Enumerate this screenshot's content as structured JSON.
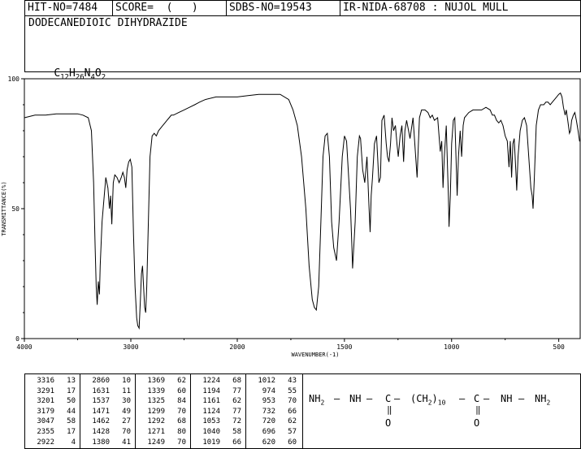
{
  "header": {
    "hit_no": "HIT-NO=7484",
    "score": "SCORE=  (   )",
    "sdbs_no": "SDBS-NO=19543",
    "ir_nida": "IR-NIDA-68708 : NUJOL MULL"
  },
  "compound": {
    "name": "DODECANEDIOIC DIHYDRAZIDE",
    "formula_parts": [
      "C",
      "12",
      "H",
      "26",
      "N",
      "4",
      "O",
      "2"
    ]
  },
  "chart_data": {
    "type": "line",
    "xlabel": "WAVENUMBER(-1)",
    "ylabel": "TRANSMITTANCE(%)",
    "xlim": [
      4000,
      400
    ],
    "ylim": [
      0,
      100
    ],
    "x_ticks": [
      4000,
      3000,
      2000,
      1500,
      1000,
      500
    ],
    "y_ticks": [
      0,
      50,
      100
    ],
    "x_tick_labels": [
      "4000",
      "3000",
      "2000",
      "1500",
      "1000",
      "500"
    ],
    "y_tick_labels": [
      "0",
      "50",
      "100"
    ],
    "series": [
      {
        "color": "#000000",
        "points": [
          [
            4000,
            85
          ],
          [
            3900,
            86
          ],
          [
            3800,
            86
          ],
          [
            3700,
            86.5
          ],
          [
            3600,
            86.5
          ],
          [
            3500,
            86.5
          ],
          [
            3450,
            86
          ],
          [
            3400,
            85
          ],
          [
            3370,
            80
          ],
          [
            3350,
            60
          ],
          [
            3335,
            35
          ],
          [
            3325,
            20
          ],
          [
            3316,
            13
          ],
          [
            3305,
            22
          ],
          [
            3295,
            17
          ],
          [
            3288,
            28
          ],
          [
            3270,
            45
          ],
          [
            3250,
            55
          ],
          [
            3235,
            62
          ],
          [
            3215,
            58
          ],
          [
            3201,
            50
          ],
          [
            3190,
            55
          ],
          [
            3179,
            44
          ],
          [
            3165,
            60
          ],
          [
            3150,
            63
          ],
          [
            3130,
            62
          ],
          [
            3110,
            60
          ],
          [
            3090,
            62
          ],
          [
            3075,
            64
          ],
          [
            3060,
            62
          ],
          [
            3047,
            58
          ],
          [
            3035,
            65
          ],
          [
            3020,
            68
          ],
          [
            3005,
            69
          ],
          [
            2990,
            66
          ],
          [
            2975,
            40
          ],
          [
            2960,
            20
          ],
          [
            2945,
            8
          ],
          [
            2935,
            5
          ],
          [
            2922,
            4
          ],
          [
            2910,
            15
          ],
          [
            2900,
            25
          ],
          [
            2890,
            28
          ],
          [
            2880,
            20
          ],
          [
            2870,
            12
          ],
          [
            2860,
            10
          ],
          [
            2850,
            20
          ],
          [
            2835,
            45
          ],
          [
            2820,
            70
          ],
          [
            2800,
            78
          ],
          [
            2780,
            79
          ],
          [
            2760,
            78
          ],
          [
            2740,
            80
          ],
          [
            2720,
            81
          ],
          [
            2700,
            82
          ],
          [
            2680,
            83
          ],
          [
            2660,
            84
          ],
          [
            2640,
            85
          ],
          [
            2620,
            86
          ],
          [
            2600,
            86
          ],
          [
            2550,
            87
          ],
          [
            2500,
            88
          ],
          [
            2450,
            89
          ],
          [
            2400,
            90
          ],
          [
            2355,
            91
          ],
          [
            2300,
            92
          ],
          [
            2200,
            93
          ],
          [
            2100,
            93
          ],
          [
            2000,
            93
          ],
          [
            1950,
            93.5
          ],
          [
            1900,
            94
          ],
          [
            1850,
            94
          ],
          [
            1800,
            94
          ],
          [
            1760,
            92
          ],
          [
            1740,
            88
          ],
          [
            1720,
            82
          ],
          [
            1700,
            70
          ],
          [
            1680,
            50
          ],
          [
            1665,
            28
          ],
          [
            1650,
            15
          ],
          [
            1640,
            12
          ],
          [
            1631,
            11
          ],
          [
            1620,
            20
          ],
          [
            1610,
            45
          ],
          [
            1600,
            70
          ],
          [
            1590,
            78
          ],
          [
            1580,
            79
          ],
          [
            1570,
            70
          ],
          [
            1560,
            45
          ],
          [
            1550,
            35
          ],
          [
            1537,
            30
          ],
          [
            1525,
            45
          ],
          [
            1510,
            70
          ],
          [
            1500,
            78
          ],
          [
            1490,
            76
          ],
          [
            1480,
            62
          ],
          [
            1471,
            49
          ],
          [
            1465,
            35
          ],
          [
            1462,
            27
          ],
          [
            1450,
            45
          ],
          [
            1440,
            70
          ],
          [
            1430,
            78
          ],
          [
            1425,
            77
          ],
          [
            1415,
            65
          ],
          [
            1405,
            60
          ],
          [
            1395,
            70
          ],
          [
            1385,
            50
          ],
          [
            1380,
            41
          ],
          [
            1375,
            55
          ],
          [
            1369,
            62
          ],
          [
            1360,
            75
          ],
          [
            1350,
            78
          ],
          [
            1339,
            60
          ],
          [
            1332,
            62
          ],
          [
            1325,
            84
          ],
          [
            1315,
            86
          ],
          [
            1305,
            75
          ],
          [
            1299,
            70
          ],
          [
            1292,
            68
          ],
          [
            1285,
            75
          ],
          [
            1278,
            85
          ],
          [
            1271,
            80
          ],
          [
            1262,
            82
          ],
          [
            1255,
            75
          ],
          [
            1249,
            70
          ],
          [
            1240,
            78
          ],
          [
            1232,
            82
          ],
          [
            1224,
            68
          ],
          [
            1218,
            80
          ],
          [
            1210,
            84
          ],
          [
            1194,
            77
          ],
          [
            1180,
            85
          ],
          [
            1161,
            62
          ],
          [
            1155,
            75
          ],
          [
            1150,
            85
          ],
          [
            1140,
            88
          ],
          [
            1124,
            88
          ],
          [
            1110,
            87
          ],
          [
            1100,
            85
          ],
          [
            1090,
            86
          ],
          [
            1080,
            84
          ],
          [
            1065,
            85
          ],
          [
            1053,
            72
          ],
          [
            1046,
            76
          ],
          [
            1040,
            58
          ],
          [
            1034,
            70
          ],
          [
            1025,
            82
          ],
          [
            1019,
            66
          ],
          [
            1015,
            55
          ],
          [
            1012,
            43
          ],
          [
            1006,
            55
          ],
          [
            1000,
            75
          ],
          [
            992,
            84
          ],
          [
            985,
            85
          ],
          [
            974,
            55
          ],
          [
            968,
            70
          ],
          [
            960,
            80
          ],
          [
            953,
            70
          ],
          [
            946,
            82
          ],
          [
            940,
            85
          ],
          [
            930,
            86
          ],
          [
            920,
            87
          ],
          [
            900,
            88
          ],
          [
            880,
            88
          ],
          [
            860,
            88
          ],
          [
            840,
            89
          ],
          [
            820,
            88
          ],
          [
            810,
            86
          ],
          [
            800,
            86
          ],
          [
            790,
            84
          ],
          [
            780,
            83
          ],
          [
            770,
            84
          ],
          [
            760,
            82
          ],
          [
            750,
            78
          ],
          [
            740,
            76
          ],
          [
            732,
            66
          ],
          [
            726,
            76
          ],
          [
            720,
            62
          ],
          [
            714,
            75
          ],
          [
            708,
            77
          ],
          [
            700,
            64
          ],
          [
            696,
            57
          ],
          [
            690,
            70
          ],
          [
            680,
            80
          ],
          [
            670,
            84
          ],
          [
            660,
            85
          ],
          [
            650,
            82
          ],
          [
            640,
            70
          ],
          [
            630,
            58
          ],
          [
            624,
            55
          ],
          [
            620,
            50
          ],
          [
            614,
            62
          ],
          [
            605,
            82
          ],
          [
            595,
            88
          ],
          [
            585,
            90
          ],
          [
            570,
            90
          ],
          [
            560,
            91
          ],
          [
            550,
            91
          ],
          [
            540,
            90
          ],
          [
            530,
            91
          ],
          [
            520,
            92
          ],
          [
            510,
            93
          ],
          [
            500,
            94
          ],
          [
            492,
            94.5
          ],
          [
            485,
            93
          ],
          [
            478,
            89
          ],
          [
            470,
            86
          ],
          [
            465,
            88
          ],
          [
            458,
            84
          ],
          [
            450,
            79
          ],
          [
            445,
            80
          ],
          [
            440,
            84
          ],
          [
            432,
            86
          ],
          [
            425,
            87
          ],
          [
            418,
            84
          ],
          [
            410,
            80
          ],
          [
            403,
            76
          ],
          [
            400,
            76
          ]
        ]
      }
    ]
  },
  "peak_table": {
    "columns": [
      [
        [
          "3316",
          "13"
        ],
        [
          "3291",
          "17"
        ],
        [
          "3201",
          "50"
        ],
        [
          "3179",
          "44"
        ],
        [
          "3047",
          "58"
        ],
        [
          "2355",
          "17"
        ],
        [
          "2922",
          "4"
        ]
      ],
      [
        [
          "2860",
          "10"
        ],
        [
          "1631",
          "11"
        ],
        [
          "1537",
          "30"
        ],
        [
          "1471",
          "49"
        ],
        [
          "1462",
          "27"
        ],
        [
          "1428",
          "70"
        ],
        [
          "1380",
          "41"
        ]
      ],
      [
        [
          "1369",
          "62"
        ],
        [
          "1339",
          "60"
        ],
        [
          "1325",
          "84"
        ],
        [
          "1299",
          "70"
        ],
        [
          "1292",
          "68"
        ],
        [
          "1271",
          "80"
        ],
        [
          "1249",
          "70"
        ]
      ],
      [
        [
          "1224",
          "68"
        ],
        [
          "1194",
          "77"
        ],
        [
          "1161",
          "62"
        ],
        [
          "1124",
          "77"
        ],
        [
          "1053",
          "72"
        ],
        [
          "1040",
          "58"
        ],
        [
          "1019",
          "66"
        ]
      ],
      [
        [
          "1012",
          "43"
        ],
        [
          "974",
          "55"
        ],
        [
          "953",
          "70"
        ],
        [
          "732",
          "66"
        ],
        [
          "720",
          "62"
        ],
        [
          "696",
          "57"
        ],
        [
          "620",
          "60"
        ]
      ]
    ]
  },
  "structure": {
    "nh2_left": "NH",
    "nh2_left_sub": "2",
    "nh_left": "NH",
    "c_left": "C",
    "chain_open": "(CH",
    "chain_sub": "2",
    "chain_close": ")",
    "chain_count": "10",
    "c_right": "C",
    "nh_right": "NH",
    "nh2_right": "NH",
    "nh2_right_sub": "2",
    "o_left": "O",
    "o_right": "O"
  }
}
